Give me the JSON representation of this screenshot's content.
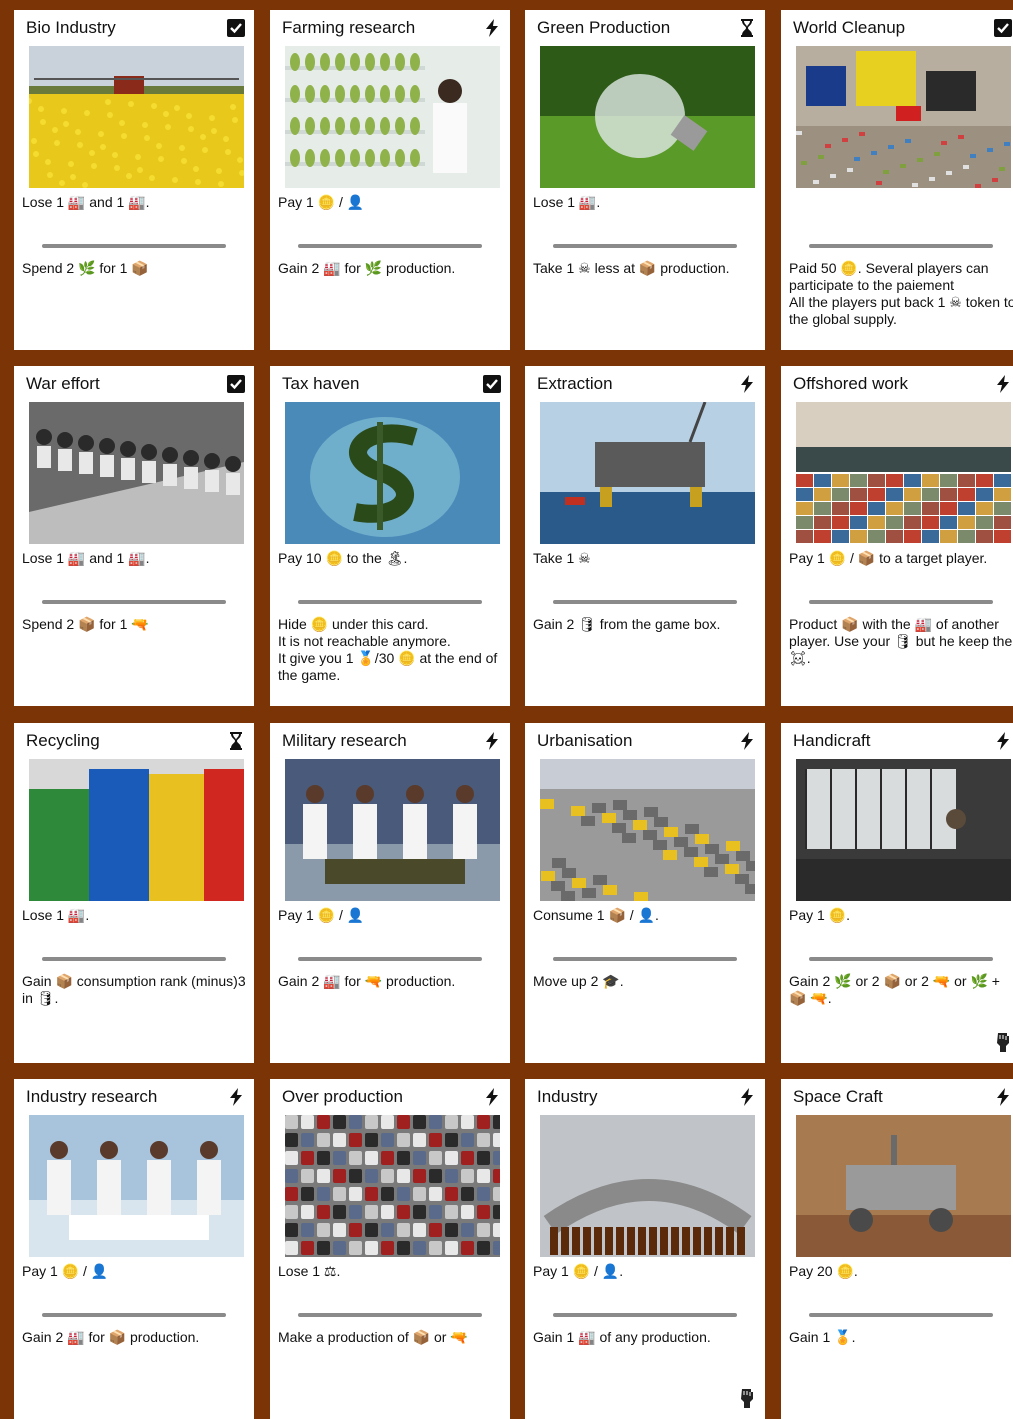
{
  "cards": [
    {
      "title": "Bio Industry",
      "type_icon": "checkbox-icon",
      "line1": "Lose 1 🏭 and 1 🏭.",
      "line2": "Spend 2 🌿 for 1 📦",
      "photo": "rapeseed-field-tractor"
    },
    {
      "title": "Farming research",
      "type_icon": "lightning-icon",
      "line1": "Pay 1 🪙 / 👤",
      "line2": "Gain 2 🏭 for 🌿 production.",
      "photo": "lab-plants"
    },
    {
      "title": "Green Production",
      "type_icon": "hourglass-icon",
      "line1": "Lose 1 🏭.",
      "line2": "Take 1 ☠ less at 📦 production.",
      "photo": "lightbulb-grass"
    },
    {
      "title": "World Cleanup",
      "type_icon": "checkbox-icon",
      "line1": "",
      "line2": "Paid 50 🪙. Several players can participate to the paiement\n All the players put back 1 ☠ token to the global supply.",
      "photo": "people-cleaning"
    },
    {
      "title": "War effort",
      "type_icon": "checkbox-icon",
      "line1": "Lose 1 🏭 and 1 🏭.",
      "line2": "Spend 2 📦 for 1 🔫",
      "photo": "factory-workers-bw"
    },
    {
      "title": "Tax haven",
      "type_icon": "checkbox-icon",
      "line1": "Pay 10 🪙 to the 🏝.",
      "line2": "Hide 🪙 under this card.\nIt is not reachable anymore.\n It give you 1 🏅/30 🪙 at the end of the game.",
      "photo": "dollar-island"
    },
    {
      "title": "Extraction",
      "type_icon": "lightning-icon",
      "line1": "Take 1 ☠",
      "line2": "Gain 2 🛢 from the game box.",
      "photo": "oil-platform"
    },
    {
      "title": "Offshored work",
      "type_icon": "lightning-icon",
      "line1": "Pay 1 🪙 / 📦 to a target player.",
      "line2": "Product 📦 with the 🏭 of another player. Use your 🛢 but he keep the ☠.",
      "photo": "container-ship"
    },
    {
      "title": "Recycling",
      "type_icon": "hourglass-icon",
      "line1": "Lose 1 🏭.",
      "line2": "Gain 📦 consumption rank (minus)3 in 🛢.",
      "photo": "recycling-bins"
    },
    {
      "title": "Military research",
      "type_icon": "lightning-icon",
      "line1": "Pay 1 🪙 / 👤",
      "line2": "Gain 2 🏭 for 🔫 production.",
      "photo": "lab-scientists"
    },
    {
      "title": "Urbanisation",
      "type_icon": "lightning-icon",
      "line1": "Consume 1 📦 / 👤.",
      "line2": "Move up 2 🎓.",
      "photo": "crowded-city"
    },
    {
      "title": "Handicraft",
      "type_icon": "lightning-icon",
      "line1": "Pay 1 🪙.",
      "line2": "Gain 2 🌿 or 2 📦 or 2 🔫 or 🌿 + 📦 🔫.",
      "photo": "workshop",
      "corner": "fist-icon"
    },
    {
      "title": "Industry research",
      "type_icon": "lightning-icon",
      "line1": "Pay 1 🪙 / 👤",
      "line2": "Gain 2 🏭 for 📦 production.",
      "photo": "lab-researchers"
    },
    {
      "title": "Over production",
      "type_icon": "lightning-icon",
      "line1": "Lose 1 ⚖.",
      "line2": "Make a production of 📦 or 🔫",
      "photo": "car-lot"
    },
    {
      "title": "Industry",
      "type_icon": "lightning-icon",
      "line1": "Pay 1 🪙 / 👤.",
      "line2": "Gain 1 🏭 of any production.",
      "photo": "bottling-line",
      "corner": "fist-icon"
    },
    {
      "title": "Space Craft",
      "type_icon": "lightning-icon",
      "line1": "Pay 20 🪙.",
      "line2": "Gain 1 🏅.",
      "photo": "mars-rover"
    }
  ],
  "colors": {
    "background": "#7a3406",
    "card": "#ffffff",
    "separator": "#8a8a8a"
  }
}
